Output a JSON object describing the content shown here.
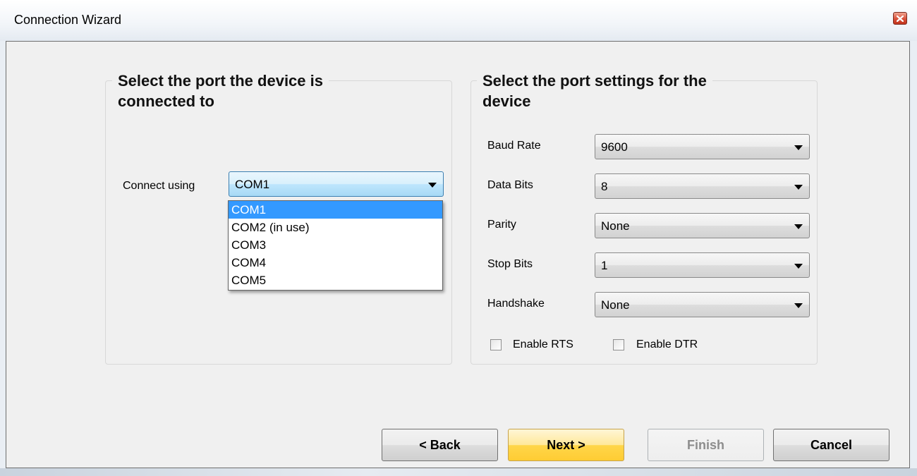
{
  "window": {
    "title": "Connection Wizard"
  },
  "port_group": {
    "title_line1": "Select the port the device is",
    "title_line2": "connected to",
    "connect_label": "Connect using",
    "port_value": "COM1",
    "port_options": [
      "COM1",
      "COM2 (in use)",
      "COM3",
      "COM4",
      "COM5"
    ]
  },
  "settings_group": {
    "title_line1": "Select the port settings for the",
    "title_line2": "device",
    "baud_rate": {
      "label": "Baud Rate",
      "value": "9600"
    },
    "data_bits": {
      "label": "Data Bits",
      "value": "8"
    },
    "parity": {
      "label": "Parity",
      "value": "None"
    },
    "stop_bits": {
      "label": "Stop Bits",
      "value": "1"
    },
    "handshake": {
      "label": "Handshake",
      "value": "None"
    },
    "enable_rts": {
      "label": "Enable RTS",
      "checked": false
    },
    "enable_dtr": {
      "label": "Enable DTR",
      "checked": false
    }
  },
  "buttons": {
    "back": "< Back",
    "next": "Next >",
    "finish": "Finish",
    "cancel": "Cancel"
  }
}
